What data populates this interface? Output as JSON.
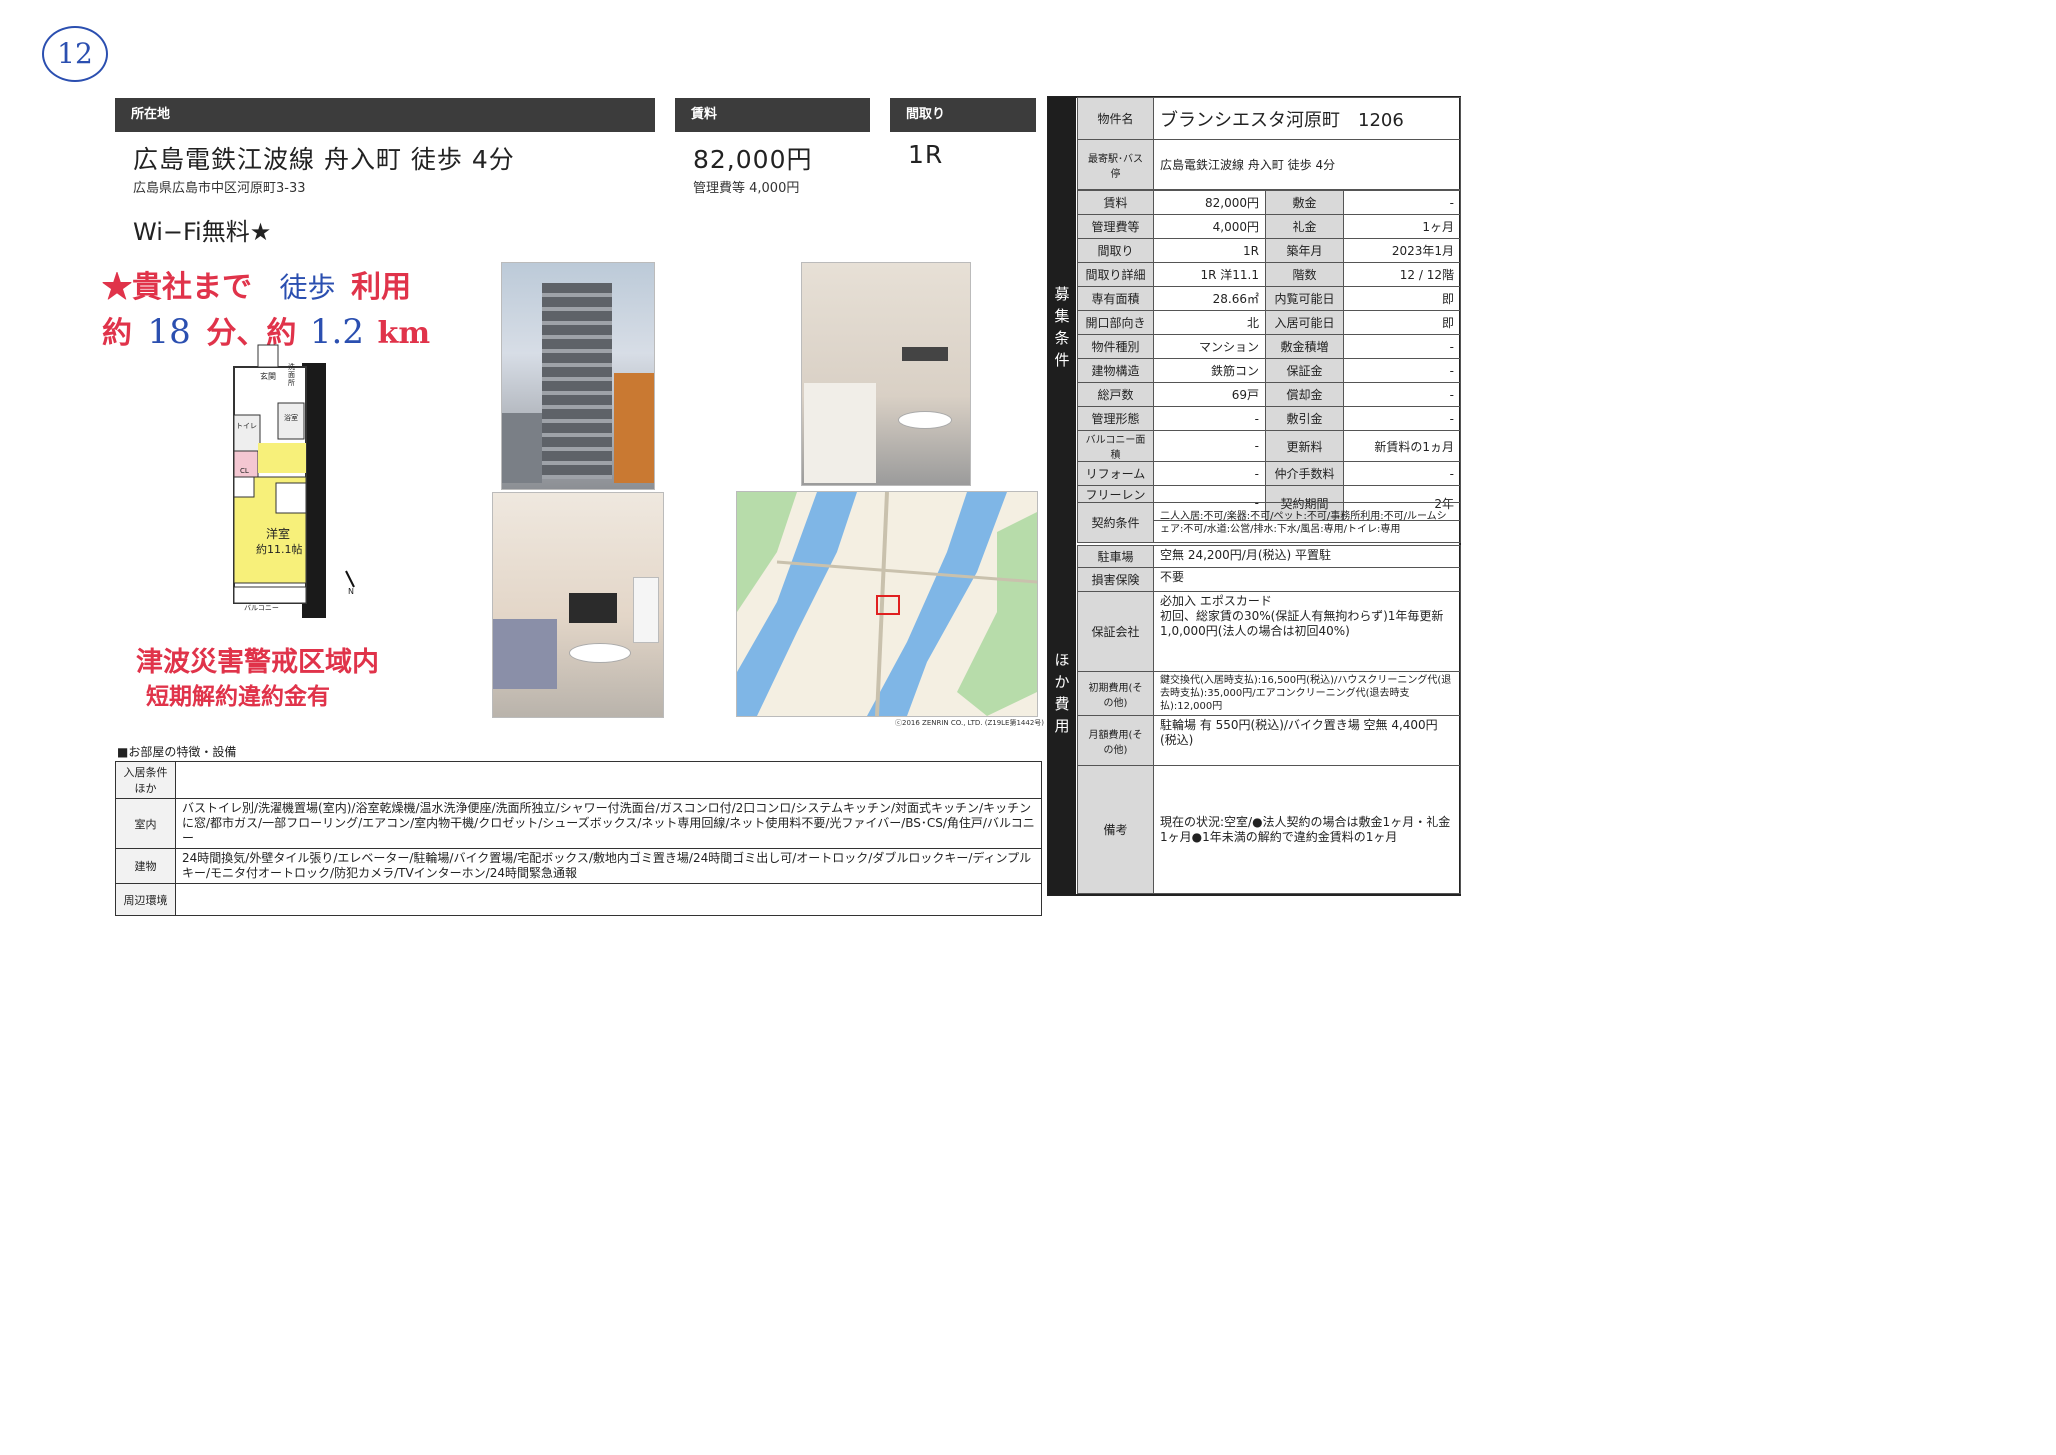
{
  "handwritten_number": "12",
  "headers": {
    "location": "所在地",
    "rent": "賃料",
    "layout": "間取り"
  },
  "main": {
    "access": "広島電鉄江波線 舟入町 徒歩 4分",
    "address": "広島県広島市中区河原町3-33",
    "wifi": "Wi−Fi無料★",
    "rent": "82,000円",
    "mgmt_fee": "管理費等 4,000円",
    "layout": "1R"
  },
  "handwritten_note": {
    "line1_red": "★貴社まで",
    "line1_blue": "徒歩",
    "line1_red2": "利用",
    "line2_red": "約",
    "line2_blue": "18",
    "line2_red2": "分、約",
    "line2_blue2": "1.2",
    "line2_red3": "km",
    "warning1": "津波災害警戒区域内",
    "warning2": "短期解約違約金有"
  },
  "floorplan": {
    "genkan": "玄関",
    "washroom": "洗面所",
    "toilet": "トイレ",
    "bath": "浴室",
    "cl": "CL",
    "room": "洋室",
    "room_size": "約11.1帖",
    "balcony": "バルコニー",
    "north": "N"
  },
  "map_copyright": "ⓒ2016 ZENRIN CO., LTD. (Z19LE第1442号)",
  "property": {
    "name_label": "物件名",
    "name": "ブランシエスタ河原町　1206",
    "station_label": "最寄駅･バス停",
    "station": "広島電鉄江波線 舟入町 徒歩 4分",
    "side_label1": "募集条件",
    "side_label2": "ほか費用",
    "rows": [
      [
        "賃料",
        "82,000円",
        "敷金",
        "-"
      ],
      [
        "管理費等",
        "4,000円",
        "礼金",
        "1ヶ月"
      ],
      [
        "間取り",
        "1R",
        "築年月",
        "2023年1月"
      ],
      [
        "間取り詳細",
        "1R 洋11.1",
        "階数",
        "12 / 12階"
      ],
      [
        "専有面積",
        "28.66㎡",
        "内覧可能日",
        "即"
      ],
      [
        "開口部向き",
        "北",
        "入居可能日",
        "即"
      ],
      [
        "物件種別",
        "マンション",
        "敷金積増",
        "-"
      ],
      [
        "建物構造",
        "鉄筋コン",
        "保証金",
        "-"
      ],
      [
        "総戸数",
        "69戸",
        "償却金",
        "-"
      ],
      [
        "管理形態",
        "-",
        "敷引金",
        "-"
      ],
      [
        "バルコニー面積",
        "-",
        "更新料",
        "新賃料の1ヵ月"
      ],
      [
        "リフォーム",
        "-",
        "仲介手数料",
        "-"
      ],
      [
        "フリーレント",
        "-",
        "契約期間",
        "2年"
      ]
    ],
    "contract_label": "契約条件",
    "contract": "二人入居:不可/楽器:不可/ペット:不可/事務所利用:不可/ルームシェア:不可/水道:公営/排水:下水/風呂:専用/トイレ:専用"
  },
  "other_costs": [
    {
      "label": "駐車場",
      "value": "空無 24,200円/月(税込) 平置駐"
    },
    {
      "label": "損害保険",
      "value": "不要"
    },
    {
      "label": "保証会社",
      "value": "必加入 エポスカード\n初回、総家賃の30%(保証人有無拘わらず)1年毎更新1,0,000円(法人の場合は初回40%)"
    },
    {
      "label": "初期費用(その他)",
      "value": "鍵交換代(入居時支払):16,500円(税込)/ハウスクリーニング代(退去時支払):35,000円/エアコンクリーニング代(退去時支払):12,000円"
    },
    {
      "label": "月額費用(その他)",
      "value": "駐輪場 有 550円(税込)/バイク置き場 空無 4,400円(税込)"
    },
    {
      "label": "備考",
      "value": "現在の状況:空室/●法人契約の場合は敷金1ヶ月・礼金1ヶ月●1年未満の解約で違約金賃料の1ヶ月"
    }
  ],
  "features": {
    "title": "■お部屋の特徴・設備",
    "rows": [
      {
        "label": "入居条件ほか",
        "value": ""
      },
      {
        "label": "室内",
        "value": "バストイレ別/洗濯機置場(室内)/浴室乾燥機/温水洗浄便座/洗面所独立/シャワー付洗面台/ガスコンロ付/2口コンロ/システムキッチン/対面式キッチン/キッチンに窓/都市ガス/一部フローリング/エアコン/室内物干機/クロゼット/シューズボックス/ネット専用回線/ネット使用料不要/光ファイバー/BS･CS/角住戸/バルコニー"
      },
      {
        "label": "建物",
        "value": "24時間換気/外壁タイル張り/エレベーター/駐輪場/バイク置場/宅配ボックス/敷地内ゴミ置き場/24時間ゴミ出し可/オートロック/ダブルロックキー/ディンプルキー/モニタ付オートロック/防犯カメラ/TVインターホン/24時間緊急通報"
      },
      {
        "label": "周辺環境",
        "value": ""
      }
    ]
  }
}
